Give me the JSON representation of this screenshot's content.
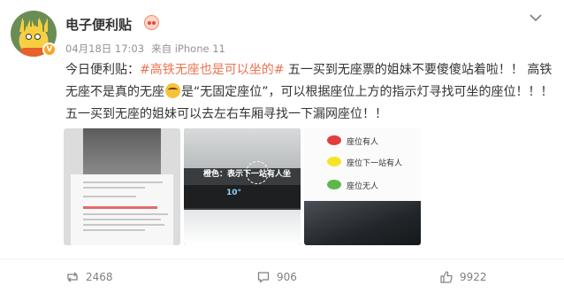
{
  "author": {
    "name": "电子便利贴",
    "verified_mark": "V"
  },
  "meta": {
    "time": "04月18日 17:03",
    "source": "来自 iPhone 11"
  },
  "post": {
    "prefix": "今日便利贴：",
    "hashtag": "#高铁无座也是可以坐的#",
    "text1": " 五一买到无座票的姐妹不要傻傻站着啦！！ 高铁无座不是真的无座",
    "text2": "是“无固定座位”，可以根据座位上方的指示灯寻找可坐的座位！！！五一买到无座的姐妹可以去左右车厢寻找一下漏网座位！！"
  },
  "images": {
    "image2_caption": "橙色：表示下一站有人坐",
    "image2_display": "10°",
    "legend": [
      {
        "label": "座位有人",
        "color": "#e23c3c"
      },
      {
        "label": "座位下一站有人",
        "color": "#f6e526"
      },
      {
        "label": "座位无人",
        "color": "#5cb84a"
      }
    ]
  },
  "actions": {
    "reposts": "2468",
    "comments": "906",
    "likes": "9922"
  },
  "icons": {
    "more": "chevron-down-icon",
    "repost": "repost-icon",
    "comment": "comment-icon",
    "like": "thumbs-up-icon"
  }
}
